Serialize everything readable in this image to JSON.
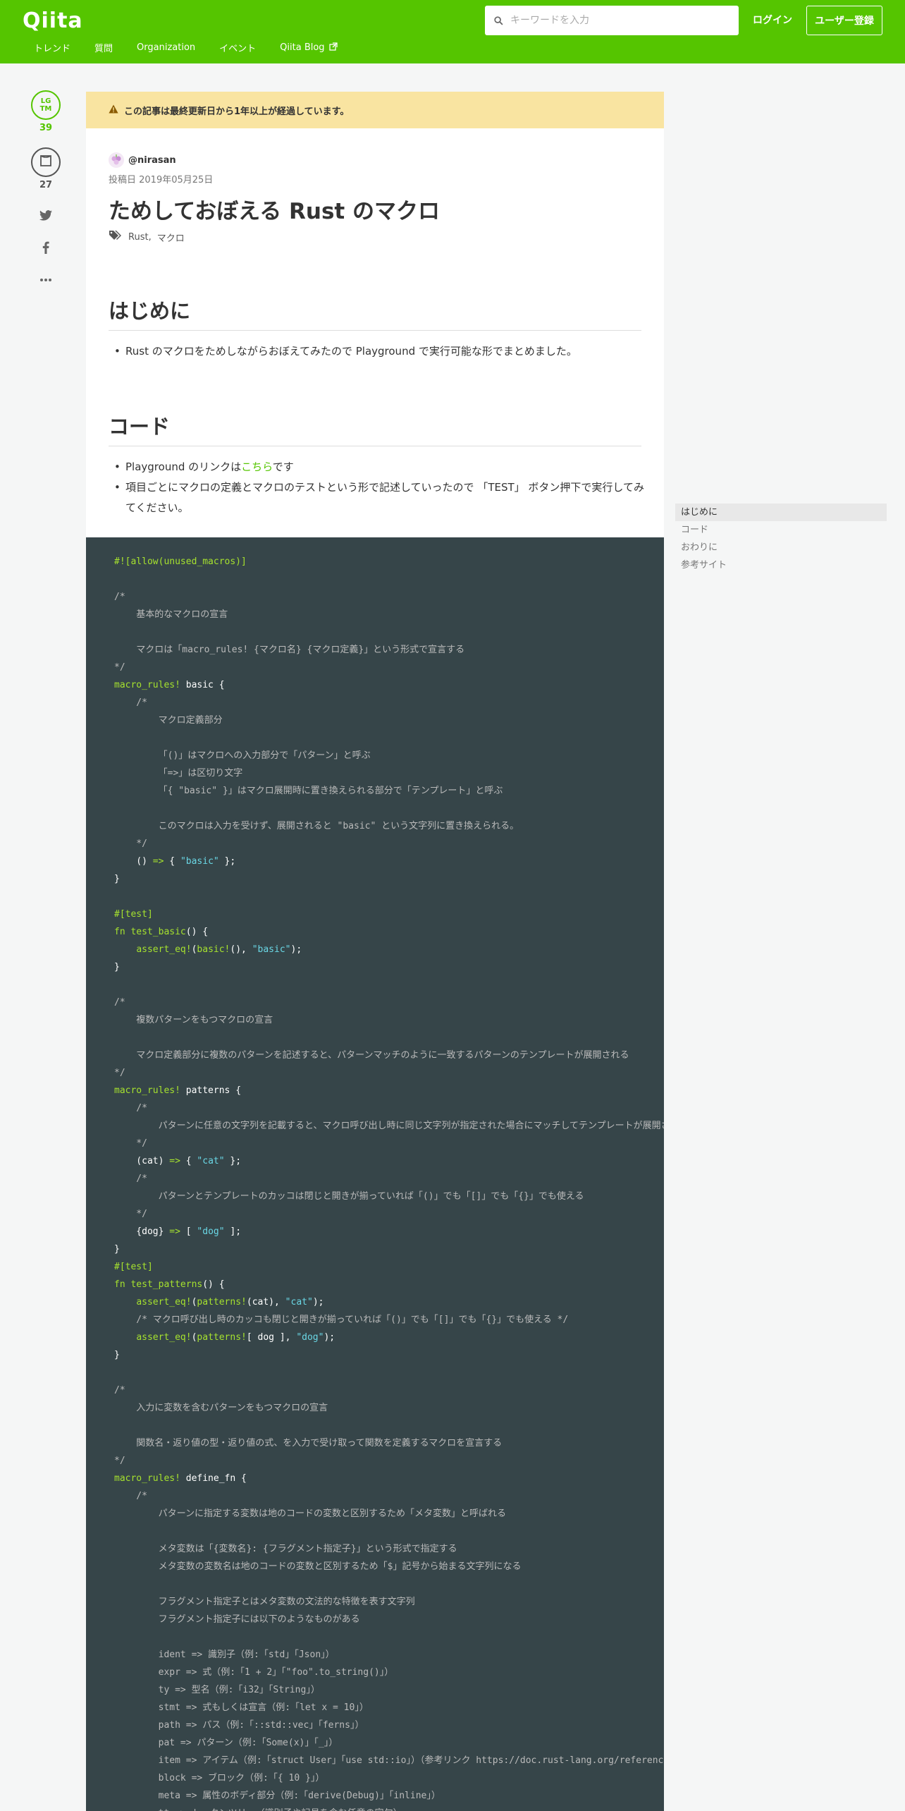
{
  "header": {
    "logo": "Qiita",
    "search_placeholder": "キーワードを入力",
    "login": "ログイン",
    "signup": "ユーザー登録",
    "nav": [
      "トレンド",
      "質問",
      "Organization",
      "イベント",
      "Qiita Blog"
    ]
  },
  "side": {
    "lgtm_label_1": "LG",
    "lgtm_label_2": "TM",
    "lgtm_count": "39",
    "stock_count": "27"
  },
  "article": {
    "warning": "この記事は最終更新日から1年以上が経過しています。",
    "author": "@nirasan",
    "posted": "投稿日 2019年05月25日",
    "title": "ためしておぼえる Rust のマクロ",
    "tags": [
      "Rust",
      "マクロ"
    ],
    "section1": {
      "heading": "はじめに",
      "items": [
        "Rust のマクロをためしながらおぼえてみたので Playground で実行可能な形でまとめました。"
      ]
    },
    "section2": {
      "heading": "コード",
      "item1_prefix": "Playground のリンクは",
      "item1_link": "こちら",
      "item1_suffix": "です",
      "item2": "項目ごとにマクロの定義とマクロのテストという形で記述していったので 「TEST」 ボタン押下で実行してみてください。"
    }
  },
  "code_lines": [
    [
      [
        "kw",
        "#![allow(unused_macros)]"
      ]
    ],
    [],
    [
      [
        "cm",
        "/*"
      ]
    ],
    [
      [
        "cm",
        "    基本的なマクロの宣言"
      ]
    ],
    [],
    [
      [
        "cm",
        "    マクロは「macro_rules! {マクロ名} {マクロ定義}」という形式で宣言する"
      ]
    ],
    [
      [
        "cm",
        "*/"
      ]
    ],
    [
      [
        "kw",
        "macro_rules!"
      ],
      [
        "nm",
        " basic {"
      ]
    ],
    [
      [
        "cm",
        "    /*"
      ]
    ],
    [
      [
        "cm",
        "        マクロ定義部分"
      ]
    ],
    [],
    [
      [
        "cm",
        "        「()」はマクロへの入力部分で「パターン」と呼ぶ"
      ]
    ],
    [
      [
        "cm",
        "        「=>」は区切り文字"
      ]
    ],
    [
      [
        "cm",
        "        「{ \"basic\" }」はマクロ展開時に置き換えられる部分で「テンプレート」と呼ぶ"
      ]
    ],
    [],
    [
      [
        "cm",
        "        このマクロは入力を受けず、展開されると \"basic\" という文字列に置き換えられる。"
      ]
    ],
    [
      [
        "cm",
        "    */"
      ]
    ],
    [
      [
        "nm",
        "    () "
      ],
      [
        "kw",
        "=>"
      ],
      [
        "nm",
        " { "
      ],
      [
        "st",
        "\"basic\""
      ],
      [
        "nm",
        " };"
      ]
    ],
    [
      [
        "nm",
        "}"
      ]
    ],
    [],
    [
      [
        "at",
        "#[test]"
      ]
    ],
    [
      [
        "kw",
        "fn"
      ],
      [
        "nm",
        " "
      ],
      [
        "kw",
        "test_basic"
      ],
      [
        "nm",
        "() {"
      ]
    ],
    [
      [
        "nm",
        "    "
      ],
      [
        "kw",
        "assert_eq!"
      ],
      [
        "nm",
        "("
      ],
      [
        "kw",
        "basic!"
      ],
      [
        "nm",
        "(), "
      ],
      [
        "st",
        "\"basic\""
      ],
      [
        "nm",
        ");"
      ]
    ],
    [
      [
        "nm",
        "}"
      ]
    ],
    [],
    [
      [
        "cm",
        "/*"
      ]
    ],
    [
      [
        "cm",
        "    複数パターンをもつマクロの宣言"
      ]
    ],
    [],
    [
      [
        "cm",
        "    マクロ定義部分に複数のパターンを記述すると、パターンマッチのように一致するパターンのテンプレートが展開される"
      ]
    ],
    [
      [
        "cm",
        "*/"
      ]
    ],
    [
      [
        "kw",
        "macro_rules!"
      ],
      [
        "nm",
        " patterns {"
      ]
    ],
    [
      [
        "cm",
        "    /*"
      ]
    ],
    [
      [
        "cm",
        "        パターンに任意の文字列を記載すると、マクロ呼び出し時に同じ文字列が指定された場合にマッチしてテンプレートが展開される"
      ]
    ],
    [
      [
        "cm",
        "    */"
      ]
    ],
    [
      [
        "nm",
        "    (cat) "
      ],
      [
        "kw",
        "=>"
      ],
      [
        "nm",
        " { "
      ],
      [
        "st",
        "\"cat\""
      ],
      [
        "nm",
        " };"
      ]
    ],
    [
      [
        "cm",
        "    /*"
      ]
    ],
    [
      [
        "cm",
        "        パターンとテンプレートのカッコは閉じと開きが揃っていれば「()」でも「[]」でも「{}」でも使える"
      ]
    ],
    [
      [
        "cm",
        "    */"
      ]
    ],
    [
      [
        "nm",
        "    {dog} "
      ],
      [
        "kw",
        "=>"
      ],
      [
        "nm",
        " [ "
      ],
      [
        "st",
        "\"dog\""
      ],
      [
        "nm",
        " ];"
      ]
    ],
    [
      [
        "nm",
        "}"
      ]
    ],
    [
      [
        "at",
        "#[test]"
      ]
    ],
    [
      [
        "kw",
        "fn"
      ],
      [
        "nm",
        " "
      ],
      [
        "kw",
        "test_patterns"
      ],
      [
        "nm",
        "() {"
      ]
    ],
    [
      [
        "nm",
        "    "
      ],
      [
        "kw",
        "assert_eq!"
      ],
      [
        "nm",
        "("
      ],
      [
        "kw",
        "patterns!"
      ],
      [
        "nm",
        "(cat), "
      ],
      [
        "st",
        "\"cat\""
      ],
      [
        "nm",
        ");"
      ]
    ],
    [
      [
        "cm",
        "    /* マクロ呼び出し時のカッコも閉じと開きが揃っていれば「()」でも「[]」でも「{}」でも使える */"
      ]
    ],
    [
      [
        "nm",
        "    "
      ],
      [
        "kw",
        "assert_eq!"
      ],
      [
        "nm",
        "("
      ],
      [
        "kw",
        "patterns!"
      ],
      [
        "nm",
        "[ dog ], "
      ],
      [
        "st",
        "\"dog\""
      ],
      [
        "nm",
        ");"
      ]
    ],
    [
      [
        "nm",
        "}"
      ]
    ],
    [],
    [
      [
        "cm",
        "/*"
      ]
    ],
    [
      [
        "cm",
        "    入力に変数を含むパターンをもつマクロの宣言"
      ]
    ],
    [],
    [
      [
        "cm",
        "    関数名・返り値の型・返り値の式、を入力で受け取って関数を定義するマクロを宣言する"
      ]
    ],
    [
      [
        "cm",
        "*/"
      ]
    ],
    [
      [
        "kw",
        "macro_rules!"
      ],
      [
        "nm",
        " define_fn {"
      ]
    ],
    [
      [
        "cm",
        "    /*"
      ]
    ],
    [
      [
        "cm",
        "        パターンに指定する変数は地のコードの変数と区別するため「メタ変数」と呼ばれる"
      ]
    ],
    [],
    [
      [
        "cm",
        "        メタ変数は「{変数名}: {フラグメント指定子}」という形式で指定する"
      ]
    ],
    [
      [
        "cm",
        "        メタ変数の変数名は地のコードの変数と区別するため「$」記号から始まる文字列になる"
      ]
    ],
    [],
    [
      [
        "cm",
        "        フラグメント指定子とはメタ変数の文法的な特徴を表す文字列"
      ]
    ],
    [
      [
        "cm",
        "        フラグメント指定子には以下のようなものがある"
      ]
    ],
    [],
    [
      [
        "cm",
        "        ident => 識別子（例:「std」「Json」）"
      ]
    ],
    [
      [
        "cm",
        "        expr => 式（例:「1 + 2」「\"foo\".to_string()」）"
      ]
    ],
    [
      [
        "cm",
        "        ty => 型名（例:「i32」「String」）"
      ]
    ],
    [
      [
        "cm",
        "        stmt => 式もしくは宣言（例:「let x = 10」）"
      ]
    ],
    [
      [
        "cm",
        "        path => パス（例:「::std::vec」「ferns」）"
      ]
    ],
    [
      [
        "cm",
        "        pat => パターン（例:「Some(x)」「_」）"
      ]
    ],
    [
      [
        "cm",
        "        item => アイテム（例:「struct User」「use std::io」）（参考リンク https://doc.rust-lang.org/reference/items.html）"
      ]
    ],
    [
      [
        "cm",
        "        block => ブロック（例:「{ 10 }」）"
      ]
    ],
    [
      [
        "cm",
        "        meta => 属性のボディ部分（例:「derive(Debug)」「inline」）"
      ]
    ],
    [
      [
        "cm",
        "        tt => トークンツリー（識別子や記号を含む任意の字句）"
      ]
    ]
  ],
  "toc": [
    "はじめに",
    "コード",
    "おわりに",
    "参考サイト"
  ],
  "colors": {
    "brand": "#55c500",
    "code_bg": "#364549",
    "warning_bg": "#f9e4a1"
  }
}
